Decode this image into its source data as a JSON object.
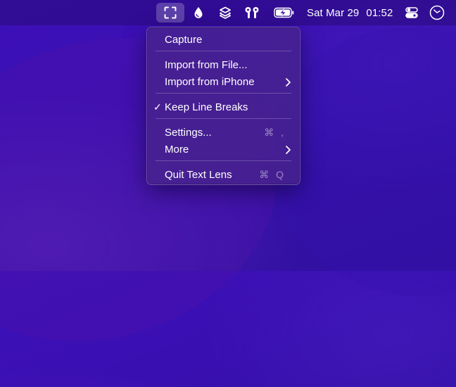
{
  "menubar": {
    "icons": {
      "capture": "text-capture-icon",
      "drop": "drop-icon",
      "shortcuts": "shortcuts-icon",
      "airpods": "airpods-icon",
      "battery": "battery-charging-icon",
      "control_center": "control-center-icon",
      "clock_app": "clock-icon"
    },
    "date": "Sat Mar 29",
    "time": "01:52"
  },
  "menu": {
    "capture": "Capture",
    "import_file": "Import from File...",
    "import_iphone": "Import from iPhone",
    "keep_line_breaks": "Keep Line Breaks",
    "keep_line_breaks_checked": true,
    "check_mark": "✓",
    "settings": "Settings...",
    "settings_shortcut": "⌘ ,",
    "more": "More",
    "quit": "Quit Text Lens",
    "quit_shortcut": "⌘ Q"
  },
  "colors": {
    "wallpaper": "#3a0fb2",
    "menu_background": "#48248c",
    "shortcut_text": "#9c8fc4"
  }
}
